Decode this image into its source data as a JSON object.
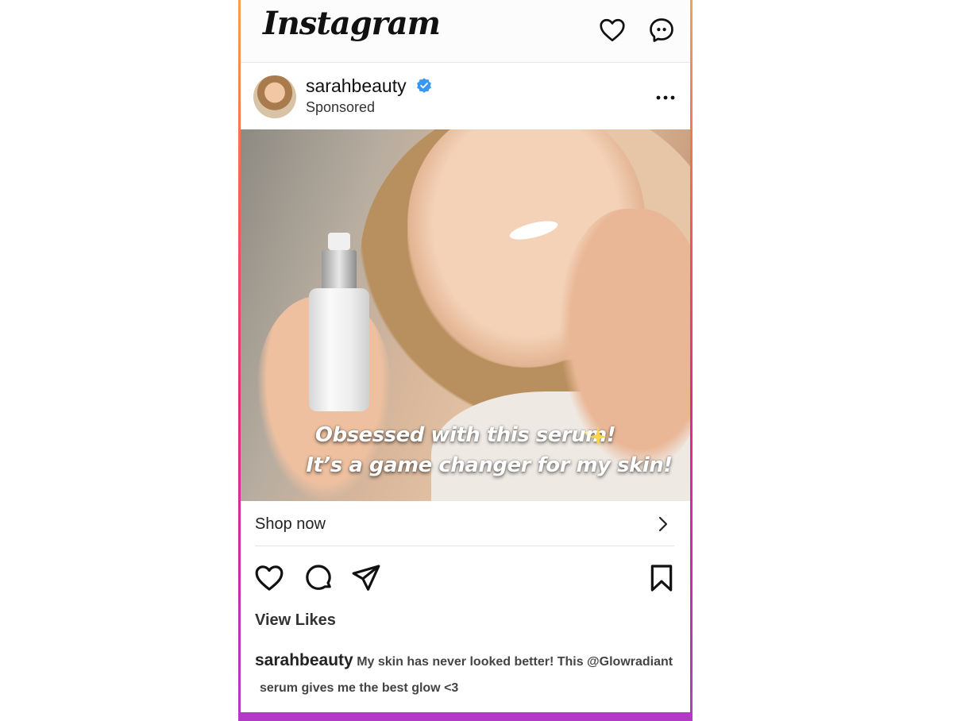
{
  "app": {
    "logo": "Instagram"
  },
  "post": {
    "username": "sarahbeauty",
    "sponsored_label": "Sponsored",
    "verified": true,
    "overlay_line1": "Obsessed with this serum!",
    "overlay_line2": "It’s a game changer for my skin!",
    "shop_label": "Shop now",
    "view_likes": "View Likes",
    "caption_user": "sarahbeauty",
    "caption_line1": "My skin has never looked better! This @Glowradiant",
    "caption_line2": "serum gives me the best glow <3"
  },
  "icons": {
    "top": [
      "heart-icon",
      "messenger-icon"
    ],
    "header": [
      "more-icon",
      "verified-badge-icon"
    ],
    "actions": [
      "heart-icon",
      "comment-icon",
      "send-icon",
      "bookmark-icon"
    ],
    "shop": "chevron-right-icon"
  },
  "colors": {
    "verified_blue": "#3897f0",
    "frame_gradient_top": "#f9a04a",
    "frame_gradient_bottom": "#b23bc6",
    "text_primary": "#111111"
  }
}
